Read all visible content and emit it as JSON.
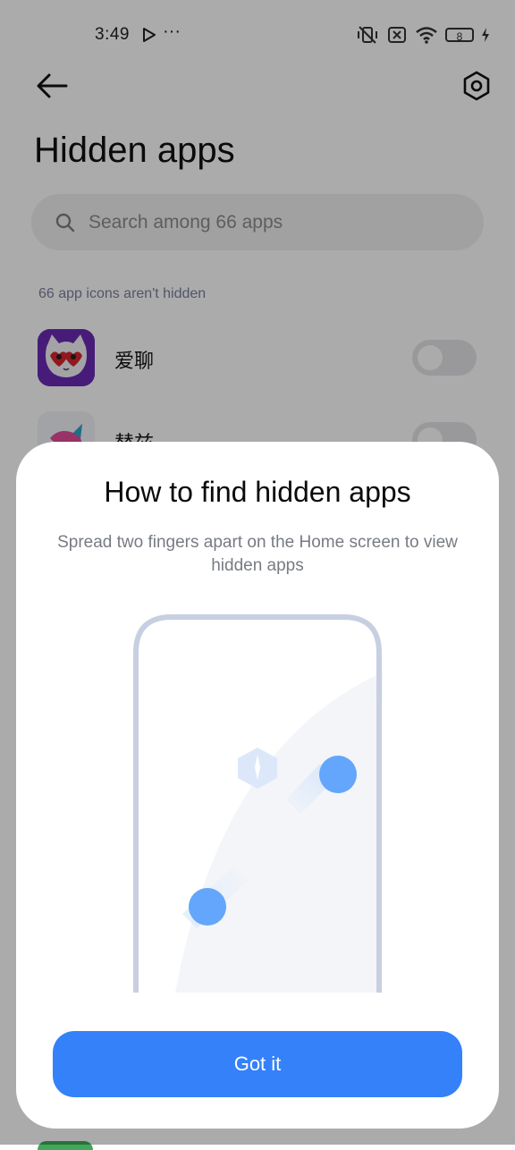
{
  "status_bar": {
    "time": "3:49",
    "more": "···",
    "battery": "8"
  },
  "header": {
    "title": "Hidden apps"
  },
  "search": {
    "placeholder": "Search among 66 apps"
  },
  "list": {
    "caption": "66 app icons aren't hidden",
    "items": [
      {
        "name": "爱聊",
        "hidden": false
      },
      {
        "name": "替兹",
        "hidden": false
      }
    ]
  },
  "dialog": {
    "title": "How to find hidden apps",
    "description": "Spread two fingers apart on the Home screen to view hidden apps",
    "button_label": "Got it"
  },
  "colors": {
    "accent": "#3481fa",
    "scrim": "rgba(0,0,0,0.33)"
  }
}
